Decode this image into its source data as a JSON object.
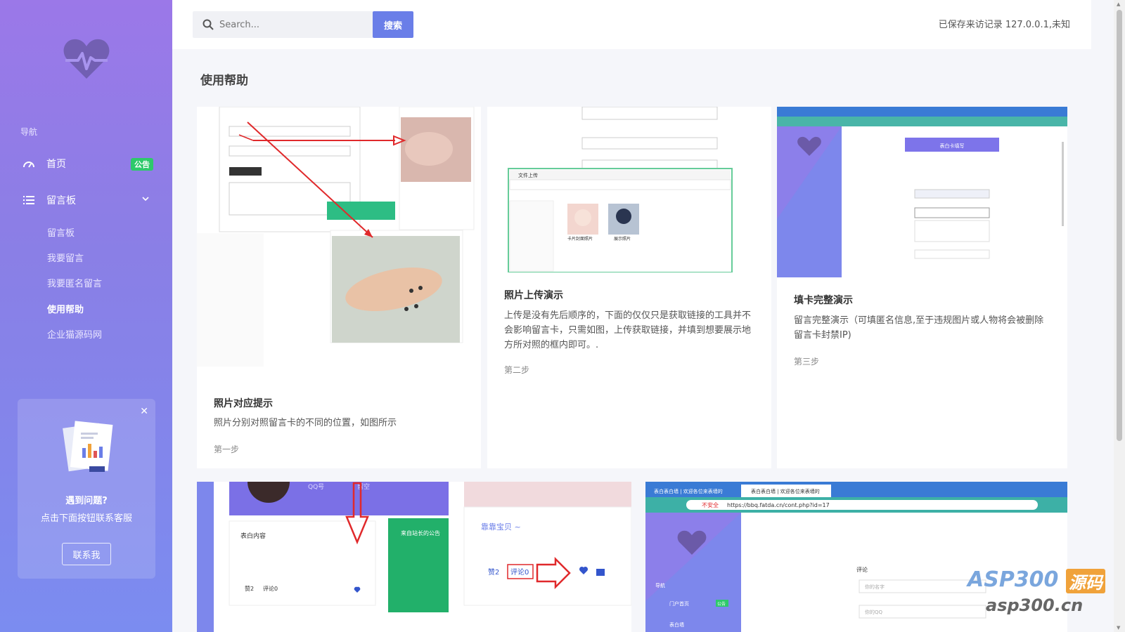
{
  "sidebar": {
    "nav_title": "导航",
    "home": {
      "label": "首页",
      "badge": "公告"
    },
    "board": {
      "label": "留言板"
    },
    "sub_items": [
      "留言板",
      "我要留言",
      "我要匿名留言",
      "使用帮助",
      "企业猫源码网"
    ],
    "active_item": "使用帮助",
    "help_card": {
      "title": "遇到问题?",
      "subtitle": "点击下面按钮联系客服",
      "button": "联系我"
    }
  },
  "topbar": {
    "search_placeholder": "Search...",
    "search_button": "搜索",
    "visit_info": "已保存来访记录 127.0.0.1,未知"
  },
  "page": {
    "title": "使用帮助"
  },
  "cards": [
    {
      "title": "照片对应提示",
      "desc": "照片分别对照留言卡的不同的位置，如图所示",
      "step": "第一步"
    },
    {
      "title": "照片上传演示",
      "desc": "上传是没有先后顺序的，下面的仅仅只是获取链接的工具并不会影响留言卡，只需如图，上传获取链接，并填到想要展示地方所对照的框内即可。.",
      "step": "第二步"
    },
    {
      "title": "填卡完整演示",
      "desc": "留言完整演示（可填匿名信息,至于违规图片或人物将会被删除留言卡封禁IP)",
      "step": "第三步"
    }
  ],
  "screenshots": {
    "upload_dialog_title": "文件上传",
    "file_names": [
      "卡片封面照片",
      "展示照片"
    ],
    "form_button": "表白卡填写",
    "browser_url": "https://bbq.fatda.cn/cont.php?id=17",
    "browser_tab_1": "表白表白墙 | 欢迎各位来表墙的",
    "browser_tab_2": "表白表白墙 | 欢迎各位来表墙的",
    "insecure_label": "不安全",
    "like_name": "靠靠宝贝 ~",
    "like_count": "赞2",
    "comment_count": "评论0",
    "form_comment_label": "评论",
    "form_name_placeholder": "你的名字",
    "form_qq_placeholder": "你的QQ",
    "announce_title": "来自站长的公告",
    "content_label": "表白内容",
    "qq_label": "QQ号",
    "wish_label": "留空",
    "side_nav_label": "导航",
    "side_home_label": "门户首页",
    "side_badge": "公告",
    "side_board_label": "表白墙"
  },
  "watermark": {
    "brand": "ASP300",
    "tag": "源码",
    "site": "asp300.cn"
  },
  "colors": {
    "sidebar_top": "#9b78e8",
    "sidebar_bottom": "#7b8cf0",
    "accent": "#6a7ee8",
    "badge": "#2ec96b",
    "arrow": "#e0292b"
  }
}
